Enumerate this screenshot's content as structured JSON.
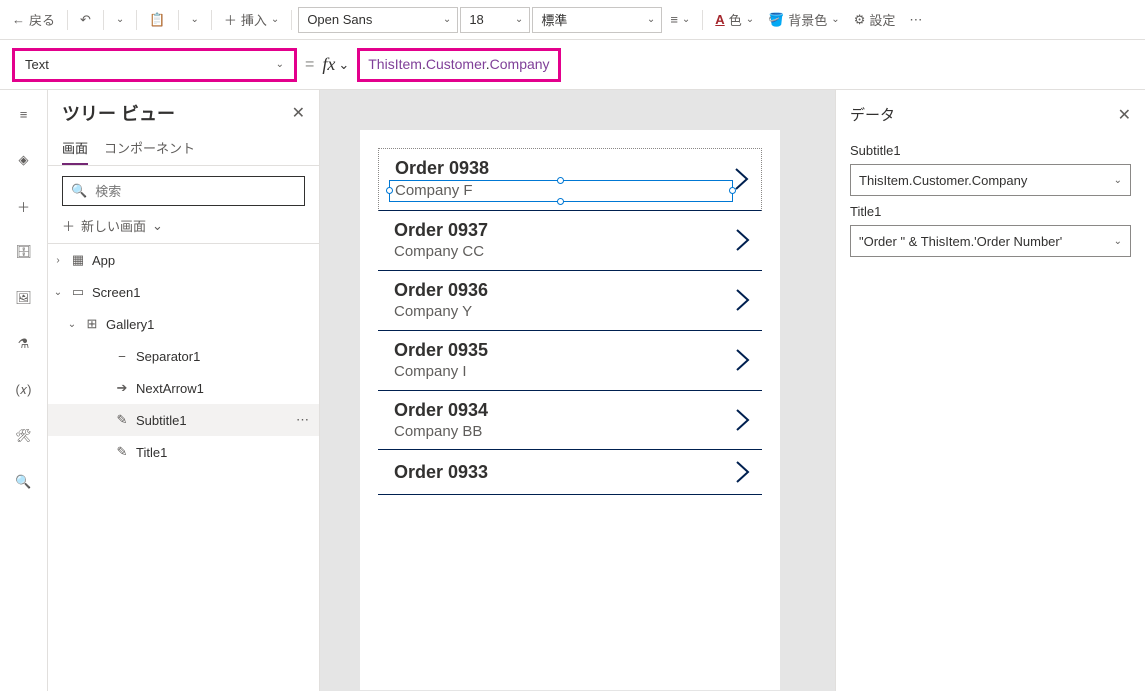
{
  "ribbon": {
    "back": "戻る",
    "insert": "挿入",
    "font_family": "Open Sans",
    "font_size": "18",
    "font_weight": "標準",
    "color": "色",
    "bgcolor": "背景色",
    "settings": "設定"
  },
  "formula": {
    "property": "Text",
    "fx": "fx",
    "this_item": "ThisItem",
    "customer": "Customer",
    "company": "Company"
  },
  "tree": {
    "title": "ツリー ビュー",
    "tab_screens": "画面",
    "tab_components": "コンポーネント",
    "search_placeholder": "検索",
    "new_screen": "新しい画面",
    "nodes": {
      "app": "App",
      "screen1": "Screen1",
      "gallery1": "Gallery1",
      "separator1": "Separator1",
      "nextarrow1": "NextArrow1",
      "subtitle1": "Subtitle1",
      "title1": "Title1"
    }
  },
  "gallery_items": [
    {
      "title": "Order 0938",
      "subtitle": "Company F"
    },
    {
      "title": "Order 0937",
      "subtitle": "Company CC"
    },
    {
      "title": "Order 0936",
      "subtitle": "Company Y"
    },
    {
      "title": "Order 0935",
      "subtitle": "Company I"
    },
    {
      "title": "Order 0934",
      "subtitle": "Company BB"
    },
    {
      "title": "Order 0933",
      "subtitle": ""
    }
  ],
  "data_panel": {
    "title": "データ",
    "fields": [
      {
        "label": "Subtitle1",
        "value": "ThisItem.Customer.Company"
      },
      {
        "label": "Title1",
        "value": "\"Order \" & ThisItem.'Order Number'"
      }
    ]
  }
}
